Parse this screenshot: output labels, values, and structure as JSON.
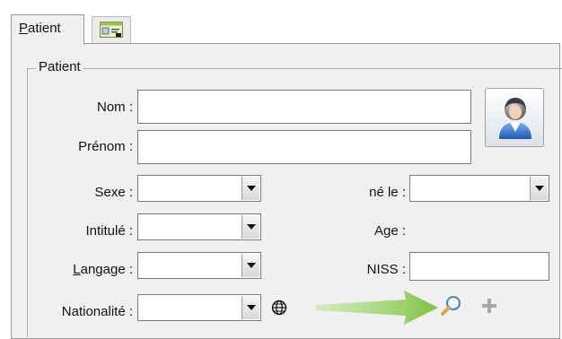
{
  "tabs": [
    {
      "label_mnemonic": "P",
      "label_rest": "atient"
    },
    {
      "icon": "id-card-icon"
    }
  ],
  "group": {
    "title": "Patient"
  },
  "fields": {
    "nom": {
      "label": "Nom :",
      "value": ""
    },
    "prenom": {
      "label": "Prénom :",
      "value": ""
    },
    "sexe": {
      "label": "Sexe :",
      "value": ""
    },
    "intitule": {
      "label": "Intitulé :",
      "value": ""
    },
    "langage": {
      "label_mnemonic": "L",
      "label_rest": "angage :",
      "value": ""
    },
    "nationalite": {
      "label": "Nationalité :",
      "value": ""
    },
    "ne_le": {
      "label": "né le :",
      "value": ""
    },
    "age": {
      "label": "Age :"
    },
    "niss": {
      "label": "NISS :",
      "value": ""
    }
  },
  "icons": {
    "photo": "person-avatar-icon",
    "globe": "globe-icon",
    "search": "magnifier-icon",
    "add": "plus-icon",
    "arrow": "green-arrow-annotation"
  },
  "colors": {
    "arrow": "#7dc142",
    "panel": "#f0f0f0"
  }
}
